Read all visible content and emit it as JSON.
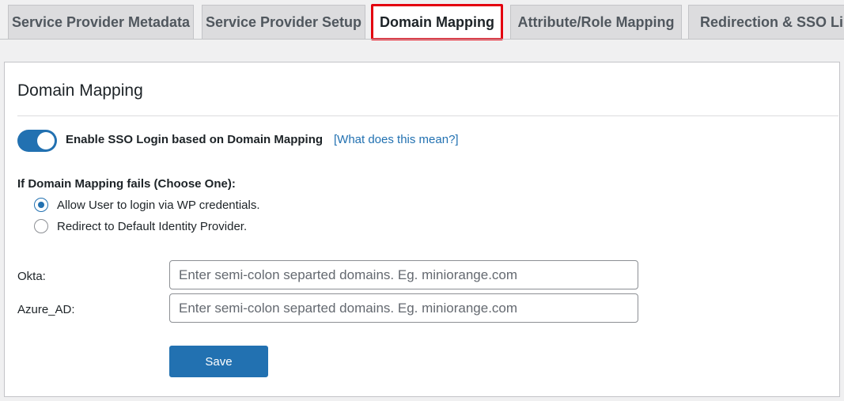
{
  "tabs": [
    {
      "label": "Service Provider Metadata",
      "active": false
    },
    {
      "label": "Service Provider Setup",
      "active": false
    },
    {
      "label": "Domain Mapping",
      "active": true
    },
    {
      "label": "Attribute/Role Mapping",
      "active": false
    },
    {
      "label": "Redirection & SSO Links",
      "active": false
    }
  ],
  "panel": {
    "title": "Domain Mapping",
    "enable_sso": {
      "label": "Enable SSO Login based on Domain Mapping",
      "help_link": "[What does this mean?]",
      "enabled": true
    },
    "fail_option": {
      "heading": "If Domain Mapping fails (Choose One):",
      "options": [
        {
          "label": "Allow User to login via WP credentials.",
          "selected": true
        },
        {
          "label": "Redirect to Default Identity Provider.",
          "selected": false
        }
      ]
    },
    "idp_fields": [
      {
        "label": "Okta:",
        "value": "",
        "placeholder": "Enter semi-colon separted domains. Eg. miniorange.com"
      },
      {
        "label": "Azure_AD:",
        "value": "",
        "placeholder": "Enter semi-colon separted domains. Eg. miniorange.com"
      }
    ],
    "save_label": "Save"
  },
  "colors": {
    "accent": "#2271b1",
    "active_tab_outline": "#e3000f",
    "background": "#f0f0f1"
  }
}
